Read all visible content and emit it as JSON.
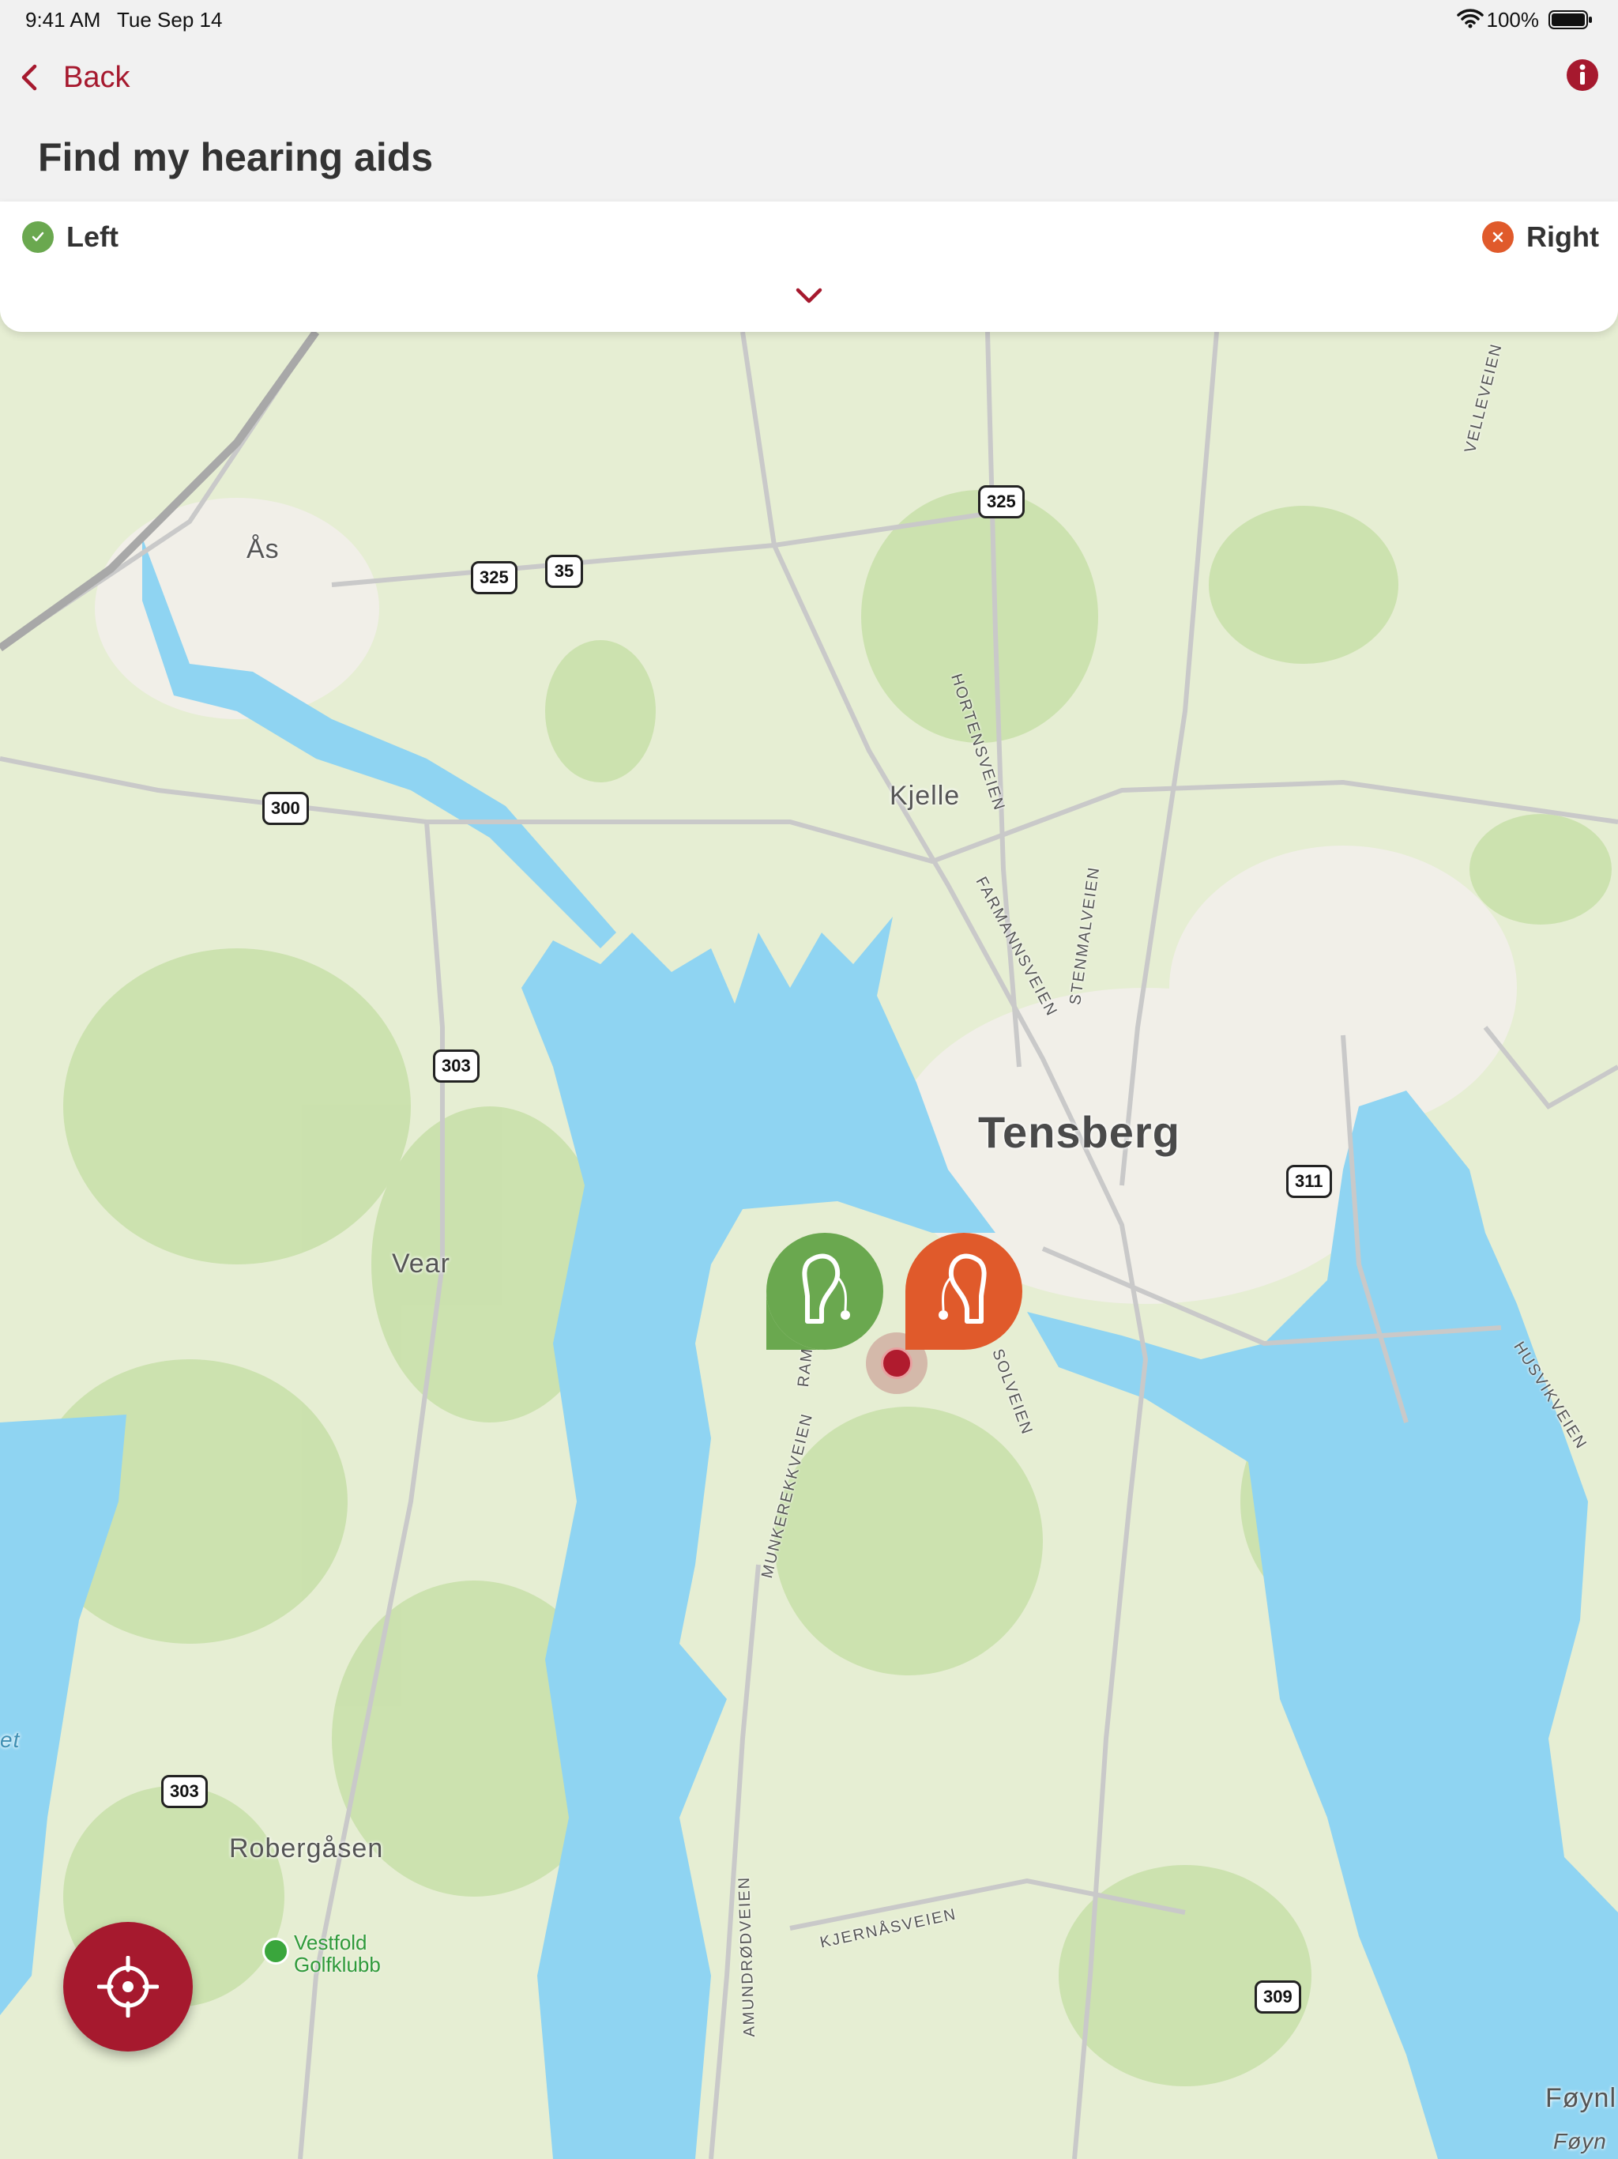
{
  "status_bar": {
    "time": "9:41 AM",
    "date": "Tue Sep 14",
    "battery": "100%"
  },
  "nav": {
    "back_label": "Back",
    "title": "Find my hearing aids"
  },
  "devices": {
    "left": {
      "label": "Left",
      "status": "connected",
      "color": "#6aa84f"
    },
    "right": {
      "label": "Right",
      "status": "disconnected",
      "color": "#e05a2b"
    }
  },
  "map": {
    "places": {
      "as": "Ås",
      "kjelle": "Kjelle",
      "tensberg": "Tensberg",
      "vear": "Vear",
      "robergasen": "Robergåsen",
      "foynland": "Føynl",
      "foynland2": "Føyn",
      "et": "et"
    },
    "golf": {
      "line1": "Vestfold",
      "line2": "Golfklubb"
    },
    "roads": {
      "r325a": "325",
      "r325b": "325",
      "r35": "35",
      "r300": "300",
      "r303a": "303",
      "r303b": "303",
      "r311": "311",
      "r309": "309"
    },
    "streets": {
      "hortensveien": "HORTENSVEIEN",
      "farmannsveien": "FARMANNSVEIEN",
      "stenmalveien": "STENMALVEIEN",
      "munkerekkveien": "MUNKEREKKVEIEN",
      "solveien": "SOLVEIEN",
      "amundrodveien": "AMUNDRØDVEIEN",
      "kjernasveien": "KJERNÅSVEIEN",
      "husvikveien": "HUSVIKVEIEN",
      "velleveien": "VELLEVEIEN",
      "ram": "RAM"
    }
  },
  "colors": {
    "accent": "#a6192e",
    "water": "#8fd4f2",
    "land": "#e8efd6",
    "park": "#c7e0a8"
  }
}
